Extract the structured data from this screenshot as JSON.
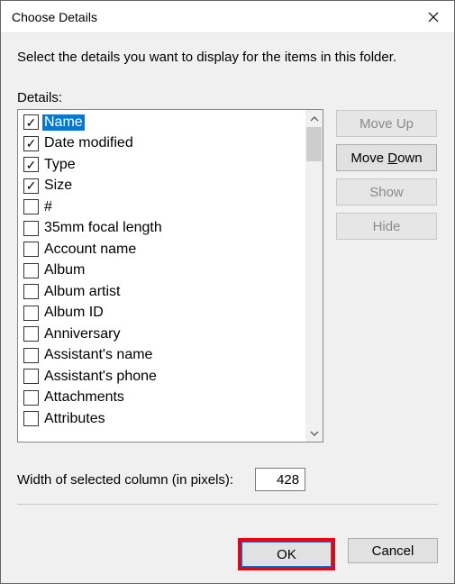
{
  "title": "Choose Details",
  "instruction": "Select the details you want to display for the items in this folder.",
  "details_label": "Details:",
  "details": [
    {
      "label": "Name",
      "checked": true,
      "selected": true
    },
    {
      "label": "Date modified",
      "checked": true,
      "selected": false
    },
    {
      "label": "Type",
      "checked": true,
      "selected": false
    },
    {
      "label": "Size",
      "checked": true,
      "selected": false
    },
    {
      "label": "#",
      "checked": false,
      "selected": false
    },
    {
      "label": "35mm focal length",
      "checked": false,
      "selected": false
    },
    {
      "label": "Account name",
      "checked": false,
      "selected": false
    },
    {
      "label": "Album",
      "checked": false,
      "selected": false
    },
    {
      "label": "Album artist",
      "checked": false,
      "selected": false
    },
    {
      "label": "Album ID",
      "checked": false,
      "selected": false
    },
    {
      "label": "Anniversary",
      "checked": false,
      "selected": false
    },
    {
      "label": "Assistant's name",
      "checked": false,
      "selected": false
    },
    {
      "label": "Assistant's phone",
      "checked": false,
      "selected": false
    },
    {
      "label": "Attachments",
      "checked": false,
      "selected": false
    },
    {
      "label": "Attributes",
      "checked": false,
      "selected": false
    }
  ],
  "side_buttons": {
    "move_up": "Move Up",
    "move_down": "Move Down",
    "show": "Show",
    "hide": "Hide"
  },
  "width_label_pre": "Width of selected column (in pixels):",
  "width_value": "428",
  "ok": "OK",
  "cancel": "Cancel",
  "emphasis": "ok"
}
